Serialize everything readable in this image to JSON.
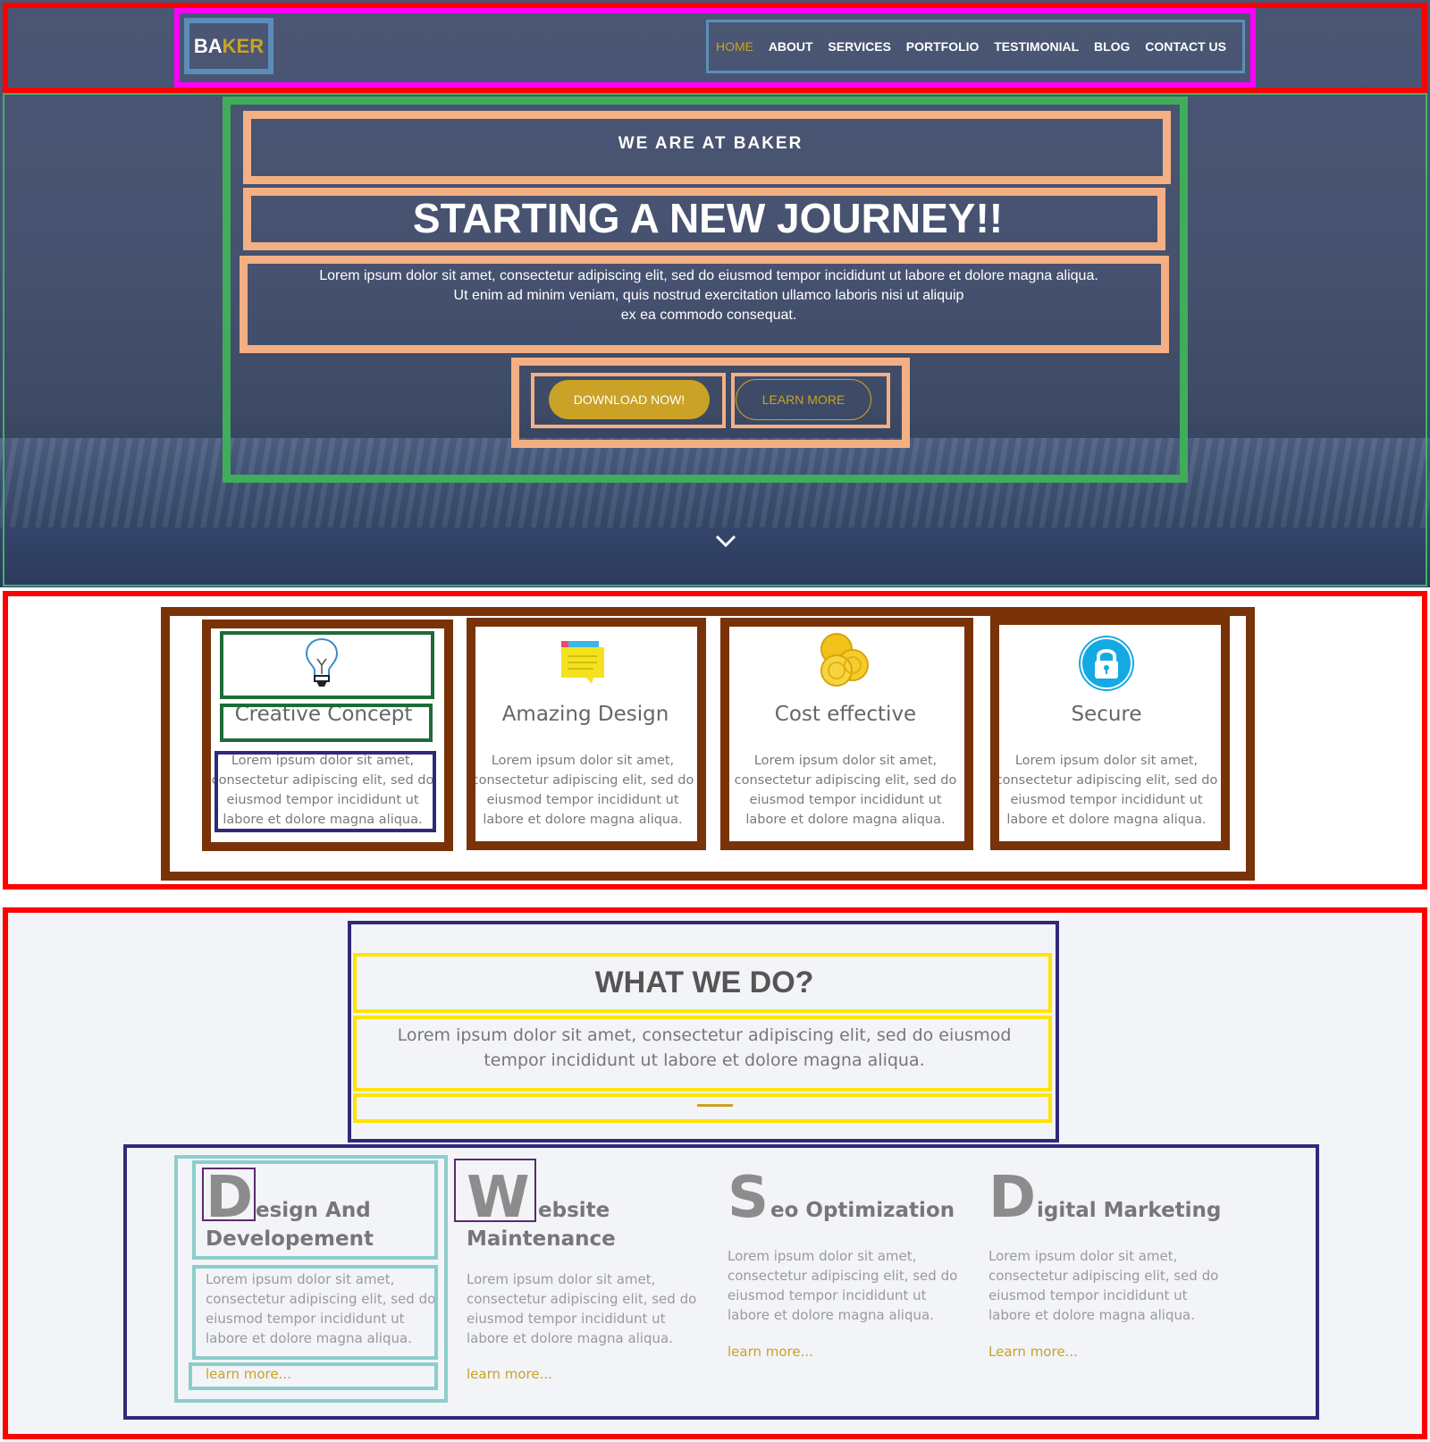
{
  "header": {
    "logo_part1": "BA",
    "logo_part2": "KER",
    "nav": [
      {
        "label": "HOME",
        "active": true
      },
      {
        "label": "ABOUT"
      },
      {
        "label": "SERVICES"
      },
      {
        "label": "PORTFOLIO"
      },
      {
        "label": "TESTIMONIAL"
      },
      {
        "label": "BLOG"
      },
      {
        "label": "CONTACT US"
      }
    ]
  },
  "hero": {
    "eyebrow": "WE ARE AT BAKER",
    "headline": "STARTING A NEW JOURNEY!!",
    "intro_lines": [
      "Lorem ipsum dolor sit amet, consectetur adipiscing elit, sed do eiusmod tempor incididunt ut labore et dolore magna aliqua.",
      "Ut enim ad minim veniam, quis nostrud exercitation ullamco laboris nisi ut aliquip",
      "ex ea commodo consequat."
    ],
    "primary_button": "DOWNLOAD NOW!",
    "secondary_button": "LEARN MORE",
    "scroll_icon": "chevron-down-icon"
  },
  "features": [
    {
      "icon": "lightbulb-icon",
      "title": "Creative Concept",
      "text_lines": [
        "Lorem ipsum dolor sit amet,",
        "consectetur adipiscing elit, sed do",
        "eiusmod tempor incididunt ut",
        "labore et dolore magna aliqua."
      ]
    },
    {
      "icon": "sticky-note-icon",
      "title": "Amazing Design",
      "text_lines": [
        "Lorem ipsum dolor sit amet,",
        "consectetur adipiscing elit, sed do",
        "eiusmod tempor incididunt ut",
        "labore et dolore magna aliqua."
      ]
    },
    {
      "icon": "coins-icon",
      "title": "Cost effective",
      "text_lines": [
        "Lorem ipsum dolor sit amet,",
        "consectetur adipiscing elit, sed do",
        "eiusmod tempor incididunt ut",
        "labore et dolore magna aliqua."
      ]
    },
    {
      "icon": "lock-icon",
      "title": "Secure",
      "text_lines": [
        "Lorem ipsum dolor sit amet,",
        "consectetur adipiscing elit, sed do",
        "eiusmod tempor incididunt ut",
        "labore et dolore magna aliqua."
      ]
    }
  ],
  "what_we_do": {
    "title": "WHAT WE DO?",
    "subtitle_lines": [
      "Lorem ipsum dolor sit amet, consectetur adipiscing elit, sed do eiusmod",
      "tempor incididunt ut labore et dolore magna aliqua."
    ],
    "services": [
      {
        "letter": "D",
        "title_rest": "esign And",
        "title_line2": "Developement",
        "text_lines": [
          "Lorem ipsum dolor sit amet,",
          "consectetur adipiscing elit, sed do",
          "eiusmod tempor incididunt ut",
          "labore et dolore magna aliqua."
        ],
        "link": "learn more..."
      },
      {
        "letter": "W",
        "title_rest": "ebsite",
        "title_line2": "Maintenance",
        "text_lines": [
          "Lorem ipsum dolor sit amet,",
          "consectetur adipiscing elit, sed do",
          "eiusmod tempor incididunt ut",
          "labore et dolore magna aliqua."
        ],
        "link": "learn more..."
      },
      {
        "letter": "S",
        "title_rest": "eo Optimization",
        "title_line2": "",
        "text_lines": [
          "Lorem ipsum dolor sit amet,",
          "consectetur adipiscing elit, sed do",
          "eiusmod tempor incididunt ut",
          "labore et dolore magna aliqua."
        ],
        "link": "learn more..."
      },
      {
        "letter": "D",
        "title_rest": "igital Marketing",
        "title_line2": "",
        "text_lines": [
          "Lorem ipsum dolor sit amet,",
          "consectetur adipiscing elit, sed do",
          "eiusmod tempor incididunt ut",
          "labore et dolore magna aliqua."
        ],
        "link": "Learn more..."
      }
    ]
  },
  "colors": {
    "accent": "#c9a227",
    "hero_bg": "#4a5673",
    "section_bg": "#f2f4f8"
  }
}
